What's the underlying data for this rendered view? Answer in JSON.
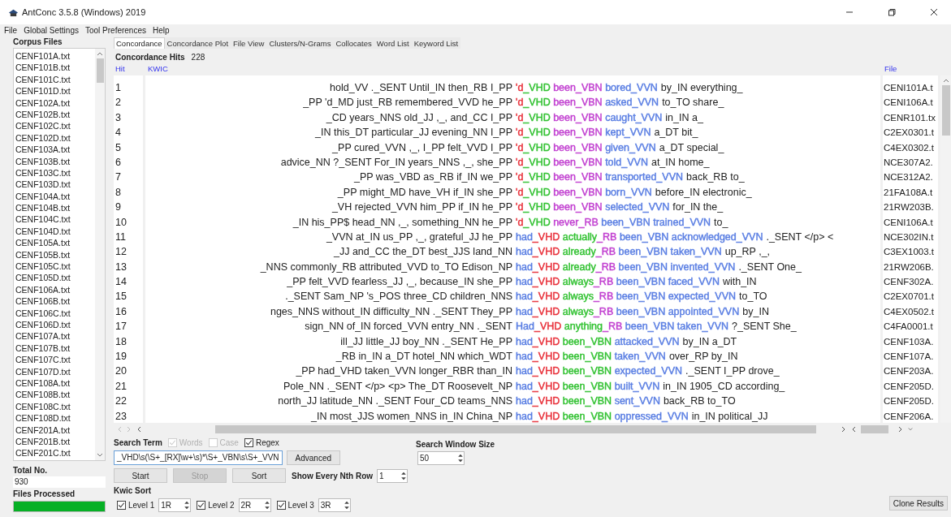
{
  "window": {
    "title": "AntConc 3.5.8 (Windows) 2019"
  },
  "menu": [
    "File",
    "Global Settings",
    "Tool Preferences",
    "Help"
  ],
  "sidebar": {
    "title": "Corpus Files",
    "files": [
      "CENF101A.txt",
      "CENF101B.txt",
      "CENF101C.txt",
      "CENF101D.txt",
      "CENF102A.txt",
      "CENF102B.txt",
      "CENF102C.txt",
      "CENF102D.txt",
      "CENF103A.txt",
      "CENF103B.txt",
      "CENF103C.txt",
      "CENF103D.txt",
      "CENF104A.txt",
      "CENF104B.txt",
      "CENF104C.txt",
      "CENF104D.txt",
      "CENF105A.txt",
      "CENF105B.txt",
      "CENF105C.txt",
      "CENF105D.txt",
      "CENF106A.txt",
      "CENF106B.txt",
      "CENF106C.txt",
      "CENF106D.txt",
      "CENF107A.txt",
      "CENF107B.txt",
      "CENF107C.txt",
      "CENF107D.txt",
      "CENF108A.txt",
      "CENF108B.txt",
      "CENF108C.txt",
      "CENF108D.txt",
      "CENF201A.txt",
      "CENF201B.txt",
      "CENF201C.txt"
    ],
    "total_label": "Total No.",
    "total": "930",
    "processed_label": "Files Processed",
    "progress": {
      "level": 1
    }
  },
  "tabs": [
    {
      "label": "Concordance",
      "selected": true
    },
    {
      "label": "Concordance Plot",
      "selected": false
    },
    {
      "label": "File View",
      "selected": false
    },
    {
      "label": "Clusters/N-Grams",
      "selected": false
    },
    {
      "label": "Collocates",
      "selected": false
    },
    {
      "label": "Word List",
      "selected": false
    },
    {
      "label": "Keyword List",
      "selected": false
    }
  ],
  "hits": {
    "label": "Concordance Hits",
    "count": "228"
  },
  "columns": {
    "hit": "Hit",
    "kwic": "KWIC",
    "file": "File"
  },
  "lines": [
    {
      "hit": "1",
      "left": "hold_VV ._SENT  Until_IN then_RB I_PP",
      "words": [
        [
          {
            "text": "'d",
            "color": "#e8303a"
          },
          {
            "text": "_VHD",
            "color": "#33c233"
          }
        ],
        [
          {
            "text": "been_VBN",
            "color": "#c13fd0"
          }
        ],
        [
          {
            "text": "bored_VVN",
            "color": "#5b7fe3"
          }
        ]
      ],
      "right": "by_IN everything_",
      "file": "CENI101A.t"
    },
    {
      "hit": "2",
      "left": "_PP 'd_MD just_RB remembered_VVD he_PP",
      "words": [
        [
          {
            "text": "'d",
            "color": "#e8303a"
          },
          {
            "text": "_VHD",
            "color": "#33c233"
          }
        ],
        [
          {
            "text": "been_VBN",
            "color": "#c13fd0"
          }
        ],
        [
          {
            "text": "asked_VVN",
            "color": "#5b7fe3"
          }
        ]
      ],
      "right": "to_TO share_",
      "file": "CENI106A.t"
    },
    {
      "hit": "3",
      "left": "_CD years_NNS old_JJ ,_, and_CC I_PP",
      "words": [
        [
          {
            "text": "'d",
            "color": "#e8303a"
          },
          {
            "text": "_VHD",
            "color": "#33c233"
          }
        ],
        [
          {
            "text": "been_VBN",
            "color": "#c13fd0"
          }
        ],
        [
          {
            "text": "caught_VVN",
            "color": "#5b7fe3"
          }
        ]
      ],
      "right": "in_IN a_",
      "file": "CENR101.tx"
    },
    {
      "hit": "4",
      "left": "_IN this_DT particular_JJ evening_NN I_PP",
      "words": [
        [
          {
            "text": "'d",
            "color": "#e8303a"
          },
          {
            "text": "_VHD",
            "color": "#33c233"
          }
        ],
        [
          {
            "text": "been_VBN",
            "color": "#c13fd0"
          }
        ],
        [
          {
            "text": "kept_VVN",
            "color": "#5b7fe3"
          }
        ]
      ],
      "right": "a_DT bit_",
      "file": "C2EX0301.t"
    },
    {
      "hit": "5",
      "left": "_PP cured_VVN ,_, I_PP felt_VVD I_PP",
      "words": [
        [
          {
            "text": "'d",
            "color": "#e8303a"
          },
          {
            "text": "_VHD",
            "color": "#33c233"
          }
        ],
        [
          {
            "text": "been_VBN",
            "color": "#c13fd0"
          }
        ],
        [
          {
            "text": "given_VVN",
            "color": "#5b7fe3"
          }
        ]
      ],
      "right": "a_DT special_",
      "file": "C4EX0302.t"
    },
    {
      "hit": "6",
      "left": "advice_NN ?_SENT  For_IN years_NNS ,_, she_PP",
      "words": [
        [
          {
            "text": "'d",
            "color": "#e8303a"
          },
          {
            "text": "_VHD",
            "color": "#33c233"
          }
        ],
        [
          {
            "text": "been_VBN",
            "color": "#c13fd0"
          }
        ],
        [
          {
            "text": "told_VVN",
            "color": "#5b7fe3"
          }
        ]
      ],
      "right": "at_IN home_",
      "file": "NCE307A2."
    },
    {
      "hit": "7",
      "left": "_PP was_VBD as_RB if_IN we_PP",
      "words": [
        [
          {
            "text": "'d",
            "color": "#e8303a"
          },
          {
            "text": "_VHD",
            "color": "#33c233"
          }
        ],
        [
          {
            "text": "been_VBN",
            "color": "#c13fd0"
          }
        ],
        [
          {
            "text": "transported_VVN",
            "color": "#5b7fe3"
          }
        ]
      ],
      "right": "back_RB to_",
      "file": "NCE312A2."
    },
    {
      "hit": "8",
      "left": "_PP might_MD have_VH if_IN she_PP",
      "words": [
        [
          {
            "text": "'d",
            "color": "#e8303a"
          },
          {
            "text": "_VHD",
            "color": "#33c233"
          }
        ],
        [
          {
            "text": "been_VBN",
            "color": "#c13fd0"
          }
        ],
        [
          {
            "text": "born_VVN",
            "color": "#5b7fe3"
          }
        ]
      ],
      "right": "before_IN electronic_",
      "file": "21FA108A.t"
    },
    {
      "hit": "9",
      "left": "_VH rejected_VVN him_PP if_IN he_PP",
      "words": [
        [
          {
            "text": "'d",
            "color": "#e8303a"
          },
          {
            "text": "_VHD",
            "color": "#33c233"
          }
        ],
        [
          {
            "text": "been_VBN",
            "color": "#c13fd0"
          }
        ],
        [
          {
            "text": "selected_VVN",
            "color": "#5b7fe3"
          }
        ]
      ],
      "right": "for_IN the_",
      "file": "21RW203B."
    },
    {
      "hit": "10",
      "left": "_IN his_PP$ head_NN ,_, something_NN he_PP",
      "words": [
        [
          {
            "text": "'d",
            "color": "#e8303a"
          },
          {
            "text": "_VHD",
            "color": "#33c233"
          }
        ],
        [
          {
            "text": "never_RB",
            "color": "#c13fd0"
          }
        ],
        [
          {
            "text": "been_VBN",
            "color": "#5b7fe3"
          }
        ],
        [
          {
            "text": "trained_VVN",
            "color": "#5b7fe3"
          }
        ]
      ],
      "right": "to_",
      "file": "CENI106A.t"
    },
    {
      "hit": "11",
      "left": "_VVN at_IN us_PP ,_, grateful_JJ he_PP",
      "words": [
        [
          {
            "text": "had",
            "color": "#5b7fe3"
          },
          {
            "text": "_VHD",
            "color": "#e8303a"
          }
        ],
        [
          {
            "text": "actually",
            "color": "#33c233"
          },
          {
            "text": "_RB",
            "color": "#c13fd0"
          }
        ],
        [
          {
            "text": "been_VBN",
            "color": "#5b7fe3"
          }
        ],
        [
          {
            "text": "acknowledged_VVN",
            "color": "#5b7fe3"
          }
        ]
      ],
      "right": "._SENT  </p> <",
      "file": "NCE302IN.t"
    },
    {
      "hit": "12",
      "left": "_JJ and_CC the_DT best_JJS land_NN",
      "words": [
        [
          {
            "text": "had",
            "color": "#5b7fe3"
          },
          {
            "text": "_VHD",
            "color": "#e8303a"
          }
        ],
        [
          {
            "text": "already",
            "color": "#33c233"
          },
          {
            "text": "_RB",
            "color": "#c13fd0"
          }
        ],
        [
          {
            "text": "been_VBN",
            "color": "#5b7fe3"
          }
        ],
        [
          {
            "text": "taken_VVN",
            "color": "#5b7fe3"
          }
        ]
      ],
      "right": "up_RP ,_,",
      "file": "C3EX1003.t"
    },
    {
      "hit": "13",
      "left": "_NNS commonly_RB attributed_VVD to_TO Edison_NP",
      "words": [
        [
          {
            "text": "had",
            "color": "#5b7fe3"
          },
          {
            "text": "_VHD",
            "color": "#e8303a"
          }
        ],
        [
          {
            "text": "already",
            "color": "#33c233"
          },
          {
            "text": "_RB",
            "color": "#c13fd0"
          }
        ],
        [
          {
            "text": "been_VBN",
            "color": "#5b7fe3"
          }
        ],
        [
          {
            "text": "invented_VVN",
            "color": "#5b7fe3"
          }
        ]
      ],
      "right": "._SENT  One_",
      "file": "21RW206B."
    },
    {
      "hit": "14",
      "left": "_PP felt_VVD fearless_JJ ,_, because_IN she_PP",
      "words": [
        [
          {
            "text": "had",
            "color": "#5b7fe3"
          },
          {
            "text": "_VHD",
            "color": "#e8303a"
          }
        ],
        [
          {
            "text": "always",
            "color": "#33c233"
          },
          {
            "text": "_RB",
            "color": "#c13fd0"
          }
        ],
        [
          {
            "text": "been_VBN",
            "color": "#5b7fe3"
          }
        ],
        [
          {
            "text": "faced_VVN",
            "color": "#5b7fe3"
          }
        ]
      ],
      "right": "with_IN",
      "file": "CENF302A."
    },
    {
      "hit": "15",
      "left": "._SENT  Sam_NP 's_POS three_CD children_NNS",
      "words": [
        [
          {
            "text": "had",
            "color": "#5b7fe3"
          },
          {
            "text": "_VHD",
            "color": "#e8303a"
          }
        ],
        [
          {
            "text": "always",
            "color": "#33c233"
          },
          {
            "text": "_RB",
            "color": "#c13fd0"
          }
        ],
        [
          {
            "text": "been_VBN",
            "color": "#5b7fe3"
          }
        ],
        [
          {
            "text": "expected_VVN",
            "color": "#5b7fe3"
          }
        ]
      ],
      "right": "to_TO",
      "file": "C2EX0701.t"
    },
    {
      "hit": "16",
      "left": "nges_NNS without_IN difficulty_NN ._SENT  They_PP",
      "words": [
        [
          {
            "text": "had",
            "color": "#5b7fe3"
          },
          {
            "text": "_VHD",
            "color": "#e8303a"
          }
        ],
        [
          {
            "text": "always",
            "color": "#33c233"
          },
          {
            "text": "_RB",
            "color": "#c13fd0"
          }
        ],
        [
          {
            "text": "been_VBN",
            "color": "#5b7fe3"
          }
        ],
        [
          {
            "text": "appointed_VVN",
            "color": "#5b7fe3"
          }
        ]
      ],
      "right": "by_IN",
      "file": "C4EX0502.t"
    },
    {
      "hit": "17",
      "left": "sign_NN of_IN forced_VVN entry_NN ._SENT",
      "words": [
        [
          {
            "text": "Had",
            "color": "#5b7fe3"
          },
          {
            "text": "_VHD",
            "color": "#e8303a"
          }
        ],
        [
          {
            "text": "anything",
            "color": "#33c233"
          },
          {
            "text": "_RB",
            "color": "#c13fd0"
          }
        ],
        [
          {
            "text": "been_VBN",
            "color": "#5b7fe3"
          }
        ],
        [
          {
            "text": "taken_VVN",
            "color": "#5b7fe3"
          }
        ]
      ],
      "right": "?_SENT  She_",
      "file": "C4FA0001.t"
    },
    {
      "hit": "18",
      "left": "ill_JJ little_JJ boy_NN ._SENT  He_PP",
      "words": [
        [
          {
            "text": "had",
            "color": "#5b7fe3"
          },
          {
            "text": "_VHD",
            "color": "#e8303a"
          }
        ],
        [
          {
            "text": "been_VBN",
            "color": "#33c233"
          }
        ],
        [
          {
            "text": "attacked_VVN",
            "color": "#5b7fe3"
          }
        ]
      ],
      "right": "by_IN a_DT",
      "file": "CENF103A."
    },
    {
      "hit": "19",
      "left": "_RB in_IN a_DT hotel_NN which_WDT",
      "words": [
        [
          {
            "text": "had",
            "color": "#5b7fe3"
          },
          {
            "text": "_VHD",
            "color": "#e8303a"
          }
        ],
        [
          {
            "text": "been_VBN",
            "color": "#33c233"
          }
        ],
        [
          {
            "text": "taken_VVN",
            "color": "#5b7fe3"
          }
        ]
      ],
      "right": "over_RP by_IN",
      "file": "CENF107A."
    },
    {
      "hit": "20",
      "left": "_PP had_VHD taken_VVN longer_RBR than_IN",
      "words": [
        [
          {
            "text": "had",
            "color": "#5b7fe3"
          },
          {
            "text": "_VHD",
            "color": "#e8303a"
          }
        ],
        [
          {
            "text": "been_VBN",
            "color": "#33c233"
          }
        ],
        [
          {
            "text": "expected_VVN",
            "color": "#5b7fe3"
          }
        ]
      ],
      "right": "._SENT  I_PP drove_",
      "file": "CENF203A."
    },
    {
      "hit": "21",
      "left": "Pole_NN ._SENT  </p> <p> The_DT Roosevelt_NP",
      "words": [
        [
          {
            "text": "had",
            "color": "#5b7fe3"
          },
          {
            "text": "_VHD",
            "color": "#e8303a"
          }
        ],
        [
          {
            "text": "been_VBN",
            "color": "#33c233"
          }
        ],
        [
          {
            "text": "built_VVN",
            "color": "#5b7fe3"
          }
        ]
      ],
      "right": "in_IN 1905_CD according_",
      "file": "CENF205D."
    },
    {
      "hit": "22",
      "left": "north_JJ latitude_NN ._SENT  Four_CD teams_NNS",
      "words": [
        [
          {
            "text": "had",
            "color": "#5b7fe3"
          },
          {
            "text": "_VHD",
            "color": "#e8303a"
          }
        ],
        [
          {
            "text": "been_VBN",
            "color": "#33c233"
          }
        ],
        [
          {
            "text": "sent_VVN",
            "color": "#5b7fe3"
          }
        ]
      ],
      "right": "back_RB to_TO",
      "file": "CENF205D."
    },
    {
      "hit": "23",
      "left": "_IN most_JJS women_NNS in_IN China_NP",
      "words": [
        [
          {
            "text": "had",
            "color": "#5b7fe3"
          },
          {
            "text": "_VHD",
            "color": "#e8303a"
          }
        ],
        [
          {
            "text": "been_VBN",
            "color": "#33c233"
          }
        ],
        [
          {
            "text": "oppressed_VVN",
            "color": "#5b7fe3"
          }
        ]
      ],
      "right": "in_IN political_JJ",
      "file": "CENF206A."
    }
  ],
  "search": {
    "label": "Search Term",
    "options": [
      {
        "label": "Words",
        "checked": true,
        "disabled": true
      },
      {
        "label": "Case",
        "checked": false,
        "disabled": true
      },
      {
        "label": "Regex",
        "checked": true,
        "disabled": false
      }
    ],
    "value": "_VHD\\s(\\S+_[RX]\\w+\\s)*\\S+_VBN\\s\\S+_VVN",
    "advanced": "Advanced",
    "window_label": "Search Window Size",
    "window_size": "50"
  },
  "actions": [
    {
      "label": "Start",
      "disabled": false
    },
    {
      "label": "Stop",
      "disabled": true
    },
    {
      "label": "Sort",
      "disabled": false
    }
  ],
  "nth": {
    "label": "Show Every Nth Row",
    "value": "1"
  },
  "kwic_sort": {
    "label": "Kwic Sort",
    "levels": [
      {
        "label": "Level 1",
        "checked": true,
        "value": "1R"
      },
      {
        "label": "Level 2",
        "checked": true,
        "value": "2R"
      },
      {
        "label": "Level 3",
        "checked": true,
        "value": "3R"
      }
    ]
  },
  "clone": "Clone Results"
}
